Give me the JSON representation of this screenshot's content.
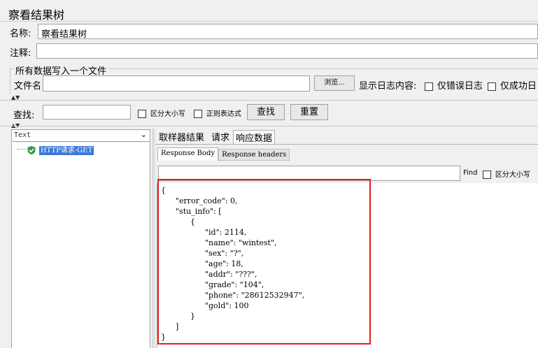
{
  "window_title": "察看结果树",
  "name_label": "名称:",
  "name_value": "察看结果树",
  "comment_label": "注释:",
  "file_group_title": "所有数据写入一个文件",
  "file_label": "文件名",
  "browse_button": "浏览...",
  "log_content_label": "显示日志内容:",
  "errors_only": "仅错误日志",
  "success_only": "仅成功日",
  "search_label": "查找:",
  "case_sensitive": "区分大小写",
  "regex": "正则表达式",
  "search_button": "查找",
  "reset_button": "重置",
  "tree_render_select": "Text",
  "tree_item": "HTTP请求-GET",
  "result_tabs": [
    "取样器结果",
    "请求",
    "响应数据"
  ],
  "response_tabs": [
    "Response Body",
    "Response headers"
  ],
  "find_label": "Find",
  "find_case": "区分大小写",
  "response_lines": [
    "{",
    "\t\"error_code\": 0,",
    "\t\"stu_info\": [",
    "\t\t{",
    "\t\t\t\"id\": 2114,",
    "\t\t\t\"name\": \"wintest\",",
    "\t\t\t\"sex\": \"?\",",
    "\t\t\t\"age\": 18,",
    "\t\t\t\"addr\": \"???\",",
    "\t\t\t\"grade\": \"104\",",
    "\t\t\t\"phone\": \"28612532947\",",
    "\t\t\t\"gold\": 100",
    "\t\t}",
    "\t]",
    "}"
  ],
  "colors": {
    "highlight_border": "#e02020",
    "selection": "#3c78d8",
    "check_green": "#2e9e3e"
  }
}
